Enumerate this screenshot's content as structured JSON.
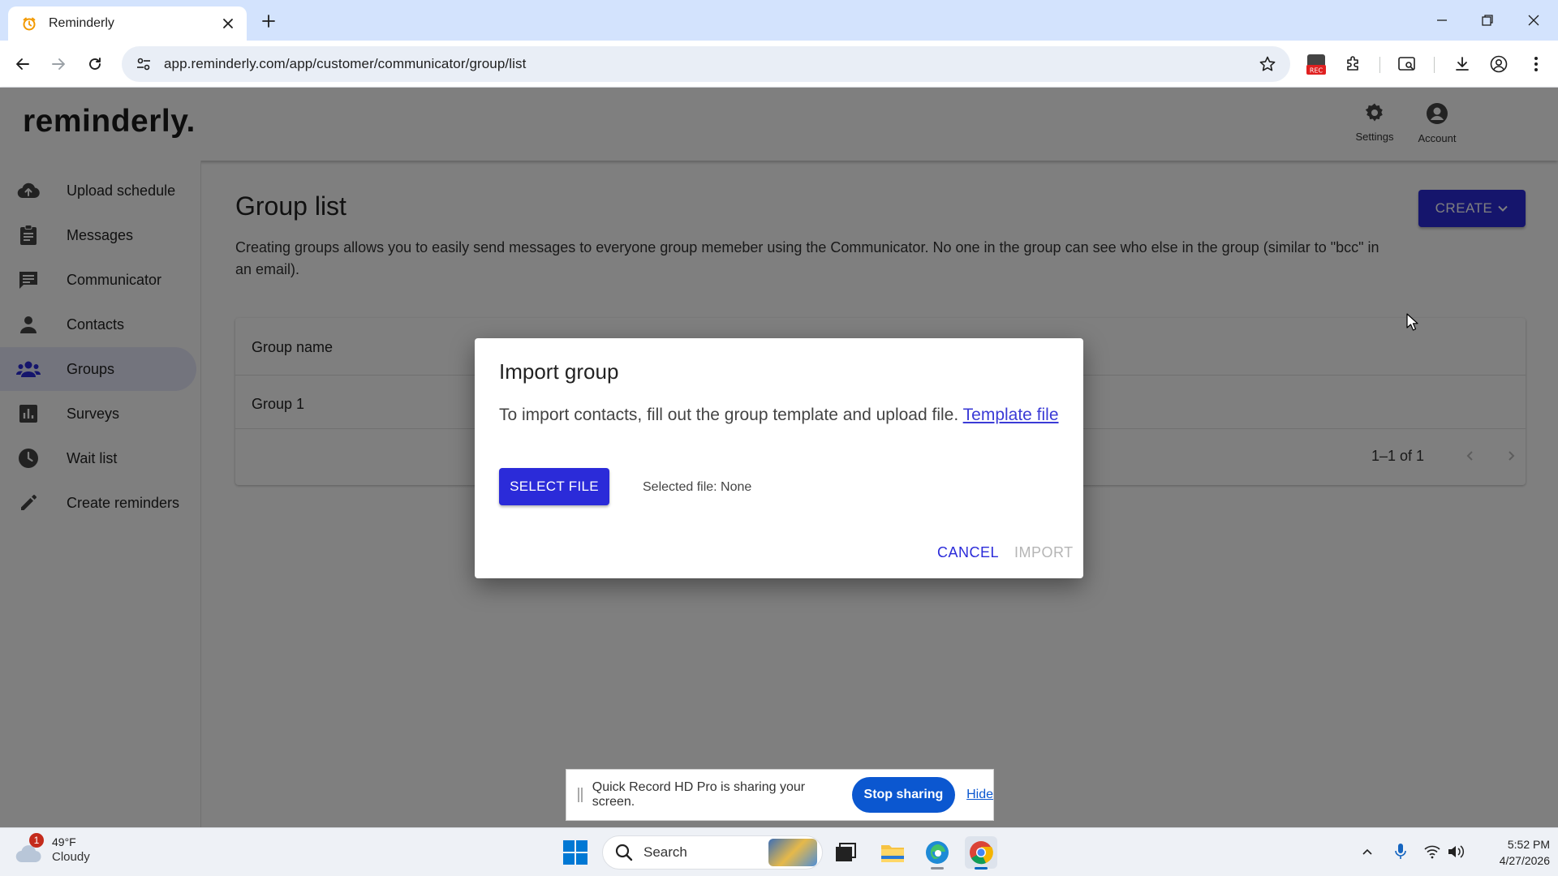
{
  "browser": {
    "tab_title": "Reminderly",
    "url": "app.reminderly.com/app/customer/communicator/group/list",
    "rec_badge": "REC"
  },
  "appbar": {
    "logo": "reminderly.",
    "settings_label": "Settings",
    "account_label": "Account"
  },
  "sidebar": {
    "items": [
      {
        "label": "Upload schedule",
        "icon": "cloud-upload-icon"
      },
      {
        "label": "Messages",
        "icon": "clipboard-icon"
      },
      {
        "label": "Communicator",
        "icon": "chat-icon"
      },
      {
        "label": "Contacts",
        "icon": "person-icon"
      },
      {
        "label": "Groups",
        "icon": "people-icon",
        "active": true
      },
      {
        "label": "Surveys",
        "icon": "bar-chart-icon"
      },
      {
        "label": "Wait list",
        "icon": "clock-icon"
      },
      {
        "label": "Create reminders",
        "icon": "pencil-icon"
      }
    ]
  },
  "main": {
    "title": "Group list",
    "description": "Creating groups allows you to easily send messages to everyone group memeber using the Communicator. No one in the group can see who else in the group (similar to \"bcc\" in an email).",
    "create_label": "CREATE",
    "table": {
      "columns": [
        "Group name"
      ],
      "rows": [
        [
          "Group 1"
        ]
      ],
      "pagination": "1–1 of 1"
    }
  },
  "dialog": {
    "title": "Import group",
    "text": "To import contacts, fill out the group template and upload file.",
    "link_text": "Template file",
    "select_file_label": "SELECT FILE",
    "selected_file": "Selected file: None",
    "cancel_label": "CANCEL",
    "import_label": "IMPORT"
  },
  "sharebar": {
    "message": "Quick Record HD Pro is sharing your screen.",
    "stop_label": "Stop sharing",
    "hide_label": "Hide"
  },
  "taskbar": {
    "weather_temp": "49°F",
    "weather_condition": "Cloudy",
    "weather_badge": "1",
    "search_label": "Search",
    "time": "5:52 PM",
    "date": "4/27/2026"
  },
  "colors": {
    "primary": "#2b2bd9",
    "active_nav": "#e6e8fb",
    "tabstrip": "#d3e3fd",
    "share_button": "#0b57d0"
  }
}
